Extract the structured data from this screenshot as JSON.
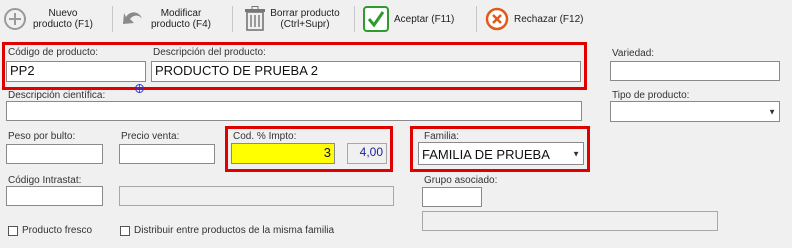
{
  "toolbar": {
    "new_label": "Nuevo\nproducto (F1)",
    "modify_label": "Modificar\nproducto (F4)",
    "delete_label": "Borrar producto\n(Ctrl+Supr)",
    "accept_label": "Aceptar (F11)",
    "reject_label": "Rechazar (F12)"
  },
  "colors": {
    "highlight": "#ffff00",
    "accent_red": "#e00000",
    "accept_green": "#2e9b2e",
    "reject_orange": "#e05a1a",
    "tax_value_text": "#2020a0"
  },
  "form": {
    "codigo_label": "Código de producto:",
    "codigo_value": "PP2",
    "descripcion_label": "Descripción del producto:",
    "descripcion_value": "PRODUCTO DE PRUEBA 2",
    "variedad_label": "Variedad:",
    "variedad_value": "",
    "desc_cientifica_label": "Descripción científica:",
    "desc_cientifica_value": "",
    "tipo_label": "Tipo de producto:",
    "tipo_value": "",
    "peso_label": "Peso por bulto:",
    "peso_value": "",
    "precio_label": "Precio venta:",
    "precio_value": "",
    "impto_label": "Cod. % Impto:",
    "impto_code": "3",
    "impto_pct": "4,00",
    "familia_label": "Familia:",
    "familia_value": "FAMILIA DE PRUEBA",
    "intrastat_label": "Código Intrastat:",
    "intrastat_value": "",
    "intrastat_desc_value": "",
    "grupo_label": "Grupo asociado:",
    "grupo_value": "",
    "grupo_desc_value": "",
    "fresco_label": "Producto fresco",
    "distribuir_label": "Distribuir entre productos de la misma familia"
  }
}
